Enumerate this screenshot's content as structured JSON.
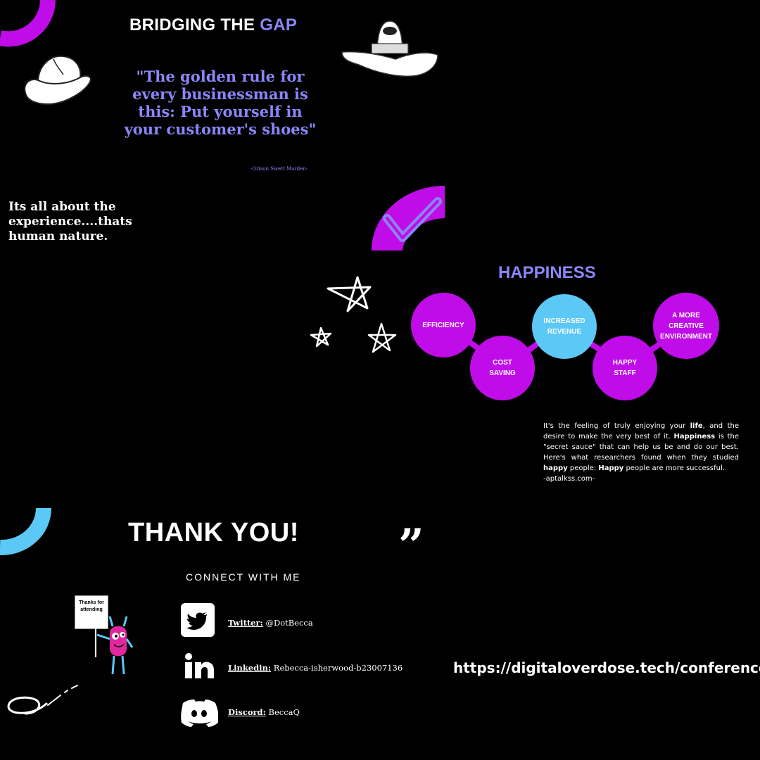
{
  "header": {
    "title_part1": "BRIDGING THE ",
    "title_part2": "GAP"
  },
  "quote": {
    "text": "\"The golden rule for every businessman is this: Put yourself in your customer's shoes\"",
    "author": "-Orison Swett Marden-"
  },
  "experience": {
    "text": "Its all about the experience....thats human nature."
  },
  "happiness": {
    "title": "HAPPINESS",
    "circles": [
      {
        "label": "EFFICIENCY"
      },
      {
        "label": "COST SAVING"
      },
      {
        "label": "INCREASED REVENUE"
      },
      {
        "label": "HAPPY STAFF"
      },
      {
        "label": "A MORE CREATIVE ENVIRONMENT"
      }
    ],
    "description": {
      "p1": "It's the feeling of truly enjoying your ",
      "b1": "life",
      "p2": ", and the desire to make the very best of it. ",
      "b2": "Happiness",
      "p3": " is the \"secret sauce\" that can help us be and do our best. Here's what researchers found when they studied ",
      "b3": "happy",
      "p4": " people: ",
      "b4": "Happy",
      "p5": " people are more successful.",
      "source": "-aptalkss.com-"
    }
  },
  "closing": {
    "thank_you": "THANK YOU!",
    "connect": "CONNECT WITH ME",
    "sign_text": "Thanks for attending",
    "socials": [
      {
        "label": "Twitter:",
        "value": " @DotBecca",
        "icon": "twitter-icon"
      },
      {
        "label": "Linkedin:",
        "value": " Rebecca-isherwood-b23007136",
        "icon": "linkedin-icon"
      },
      {
        "label": "Discord:",
        "value": " BeccaQ",
        "icon": "discord-icon"
      }
    ],
    "url": "https://digitaloverdose.tech/conference"
  },
  "colors": {
    "accent_lavender": "#8b86f7",
    "accent_purple": "#c00ce8",
    "accent_blue": "#5bc8f5",
    "background": "#000000"
  }
}
